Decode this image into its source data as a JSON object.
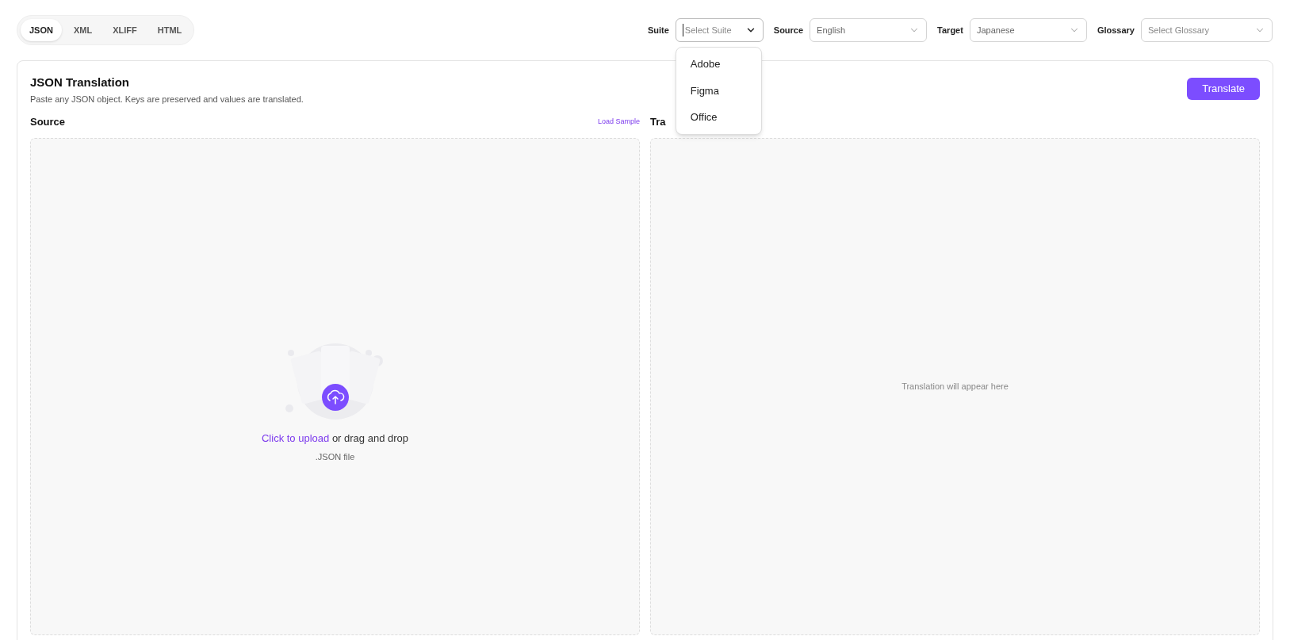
{
  "tabs": [
    {
      "label": "JSON",
      "selected": true
    },
    {
      "label": "XML",
      "selected": false
    },
    {
      "label": "XLIFF",
      "selected": false
    },
    {
      "label": "HTML",
      "selected": false
    }
  ],
  "selects": [
    {
      "label": "Suite",
      "placeholder": "Select Suite",
      "open": true,
      "options": [
        "Adobe",
        "Figma",
        "Office"
      ]
    },
    {
      "label": "Source",
      "value": "English",
      "open": false
    },
    {
      "label": "Target",
      "value": "Japanese",
      "open": false
    },
    {
      "label": "Glossary",
      "placeholder": "Select Glossary",
      "open": false
    }
  ],
  "card": {
    "title": "JSON Translation",
    "subtitle": "Paste any JSON object. Keys are preserved and values are translated.",
    "button": "Translate"
  },
  "source": {
    "label": "Source",
    "link": "Load Sample",
    "upload_link": "Click to upload",
    "upload_text": "or drag and drop",
    "file_hint": ".JSON file"
  },
  "target": {
    "label": "Tra",
    "empty_text": "Translation will appear here"
  }
}
